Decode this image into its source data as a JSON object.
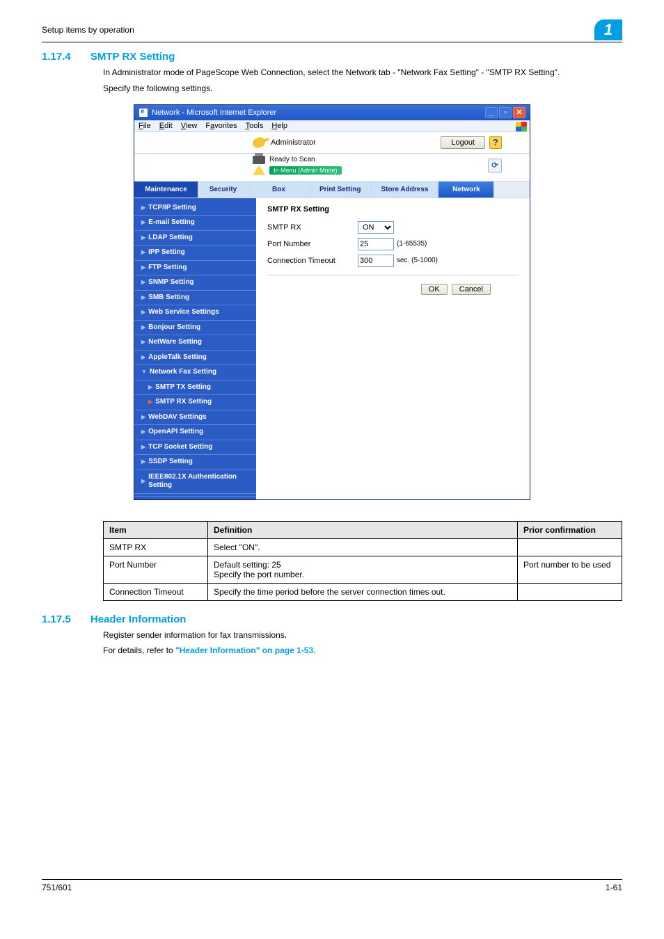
{
  "header": {
    "running_head": "Setup items by operation",
    "chapter_badge": "1"
  },
  "section1": {
    "number": "1.17.4",
    "title": "SMTP RX Setting",
    "intro1": "In Administrator mode of PageScope Web Connection, select the Network tab - \"Network Fax Setting\" - \"SMTP RX Setting\".",
    "intro2": "Specify the following settings."
  },
  "ie": {
    "title": "Network - Microsoft Internet Explorer",
    "menus": {
      "file": "File",
      "edit": "Edit",
      "view": "View",
      "favorites": "Favorites",
      "tools": "Tools",
      "help": "Help"
    },
    "admin_label": "Administrator",
    "logout": "Logout",
    "status_ready": "Ready to Scan",
    "status_mode": "In Menu (Admin Mode)",
    "tabs": {
      "maintenance": "Maintenance",
      "security": "Security",
      "box": "Box",
      "print": "Print Setting",
      "store": "Store Address",
      "network": "Network"
    },
    "sidebar": {
      "items": [
        "TCP/IP Setting",
        "E-mail Setting",
        "LDAP Setting",
        "IPP Setting",
        "FTP Setting",
        "SNMP Setting",
        "SMB Setting",
        "Web Service Settings",
        "Bonjour Setting",
        "NetWare Setting",
        "AppleTalk Setting",
        "Network Fax Setting",
        "SMTP TX Setting",
        "SMTP RX Setting",
        "WebDAV Settings",
        "OpenAPI Setting",
        "TCP Socket Setting",
        "SSDP Setting",
        "IEEE802.1X Authentication Setting"
      ]
    },
    "form": {
      "heading": "SMTP RX Setting",
      "smtp_rx_label": "SMTP RX",
      "smtp_rx_value": "ON",
      "port_label": "Port Number",
      "port_value": "25",
      "port_hint": "(1-65535)",
      "timeout_label": "Connection Timeout",
      "timeout_value": "300",
      "timeout_hint": "sec. (5-1000)",
      "ok": "OK",
      "cancel": "Cancel"
    }
  },
  "deftable": {
    "headers": {
      "item": "Item",
      "definition": "Definition",
      "prior": "Prior confirmation"
    },
    "rows": [
      {
        "item": "SMTP RX",
        "def": "Select \"ON\".",
        "prior": ""
      },
      {
        "item": "Port Number",
        "def": "Default setting: 25\nSpecify the port number.",
        "prior": "Port number to be used"
      },
      {
        "item": "Connection Timeout",
        "def": "Specify the time period before the server connection times out.",
        "prior": ""
      }
    ]
  },
  "section2": {
    "number": "1.17.5",
    "title": "Header Information",
    "line1": "Register sender information for fax transmissions.",
    "line2_pre": "For details, refer to ",
    "line2_link": "\"Header Information\" on page 1-53",
    "line2_post": "."
  },
  "footer": {
    "left": "751/601",
    "right": "1-61"
  }
}
